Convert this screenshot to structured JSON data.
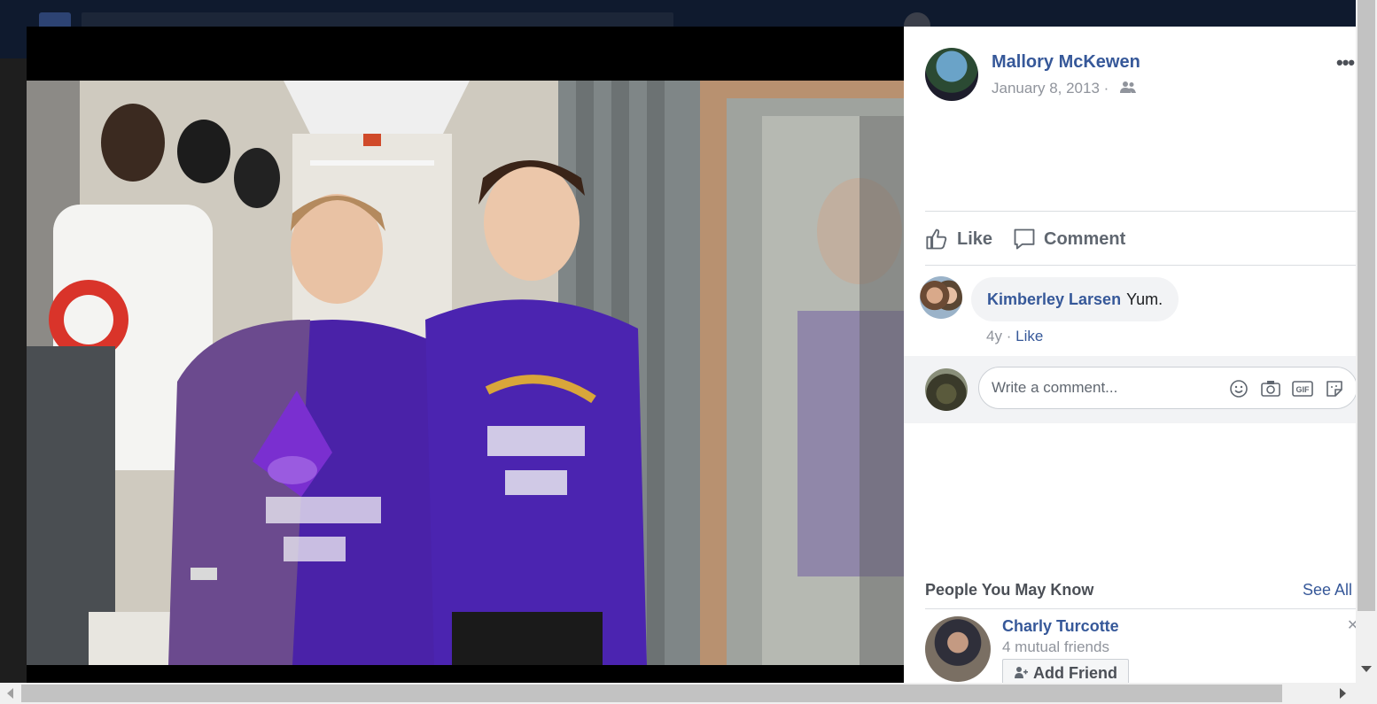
{
  "post": {
    "author": "Mallory McKewen",
    "date": "January 8, 2013 ·",
    "privacy_icon": "friends-icon",
    "more_label": "•••"
  },
  "actions": {
    "like": "Like",
    "comment": "Comment"
  },
  "comments": [
    {
      "author": "Kimberley Larsen",
      "text": "Yum.",
      "age": "4y",
      "sep": "·",
      "like": "Like"
    }
  ],
  "compose": {
    "placeholder": "Write a comment...",
    "tools": [
      "emoji-icon",
      "camera-icon",
      "gif-icon",
      "sticker-icon"
    ],
    "gif_label": "GIF"
  },
  "pymk": {
    "title": "People You May Know",
    "see_all": "See All",
    "people": [
      {
        "name": "Charly Turcotte",
        "mutual": "4 mutual friends",
        "add_label": "Add Friend"
      }
    ]
  },
  "colors": {
    "link": "#365899",
    "muted": "#90949c"
  }
}
